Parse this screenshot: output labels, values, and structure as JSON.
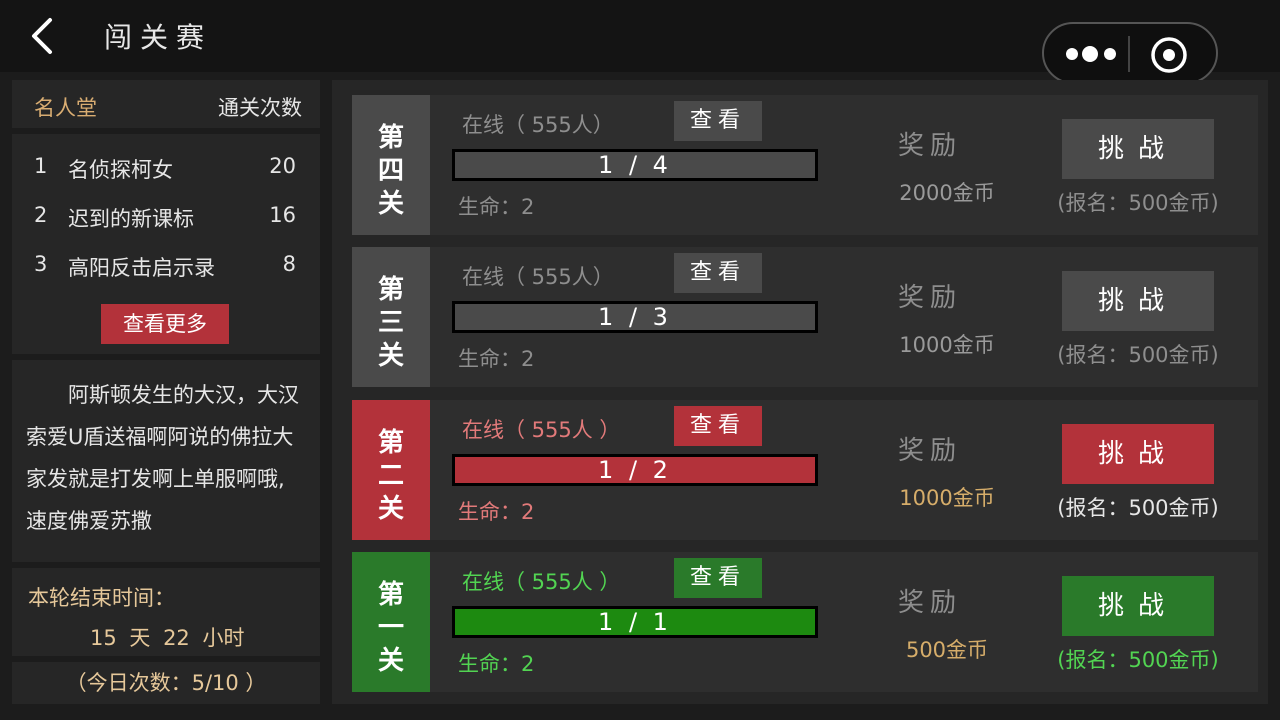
{
  "header": {
    "title": "闯关赛"
  },
  "hall": {
    "title": "名人堂",
    "count_header": "通关次数",
    "rows": [
      {
        "rank": "1",
        "name": "名侦探柯女",
        "count": "20"
      },
      {
        "rank": "2",
        "name": "迟到的新课标",
        "count": "16"
      },
      {
        "rank": "3",
        "name": "高阳反击启示录",
        "count": "8"
      }
    ],
    "more_label": "查看更多"
  },
  "description": "阿斯顿发生的大汉，大汉索爱U盾送福啊阿说的佛拉大家发就是打发啊上单服啊哦, 速度佛爱苏撒",
  "round": {
    "end_label": "本轮结束时间：",
    "end_value": "15 天 22 小时",
    "today_label": "（今日次数：5/10 ）"
  },
  "levels": [
    {
      "name": "第四关",
      "online": "在线（ 555人）",
      "view": "查看",
      "progress": "1 / 4",
      "fill": 1.0,
      "life": "生命：2",
      "reward_label": "奖励",
      "reward": "2000金币",
      "challenge": "挑战",
      "signup": "(报名：500金币)",
      "theme": "grey"
    },
    {
      "name": "第三关",
      "online": "在线（ 555人）",
      "view": "查看",
      "progress": "1 / 3",
      "fill": 1.0,
      "life": "生命：2",
      "reward_label": "奖励",
      "reward": "1000金币",
      "challenge": "挑战",
      "signup": "(报名：500金币)",
      "theme": "grey"
    },
    {
      "name": "第二关",
      "online": "在线（ 555人 ）",
      "view": "查看",
      "progress": "1 / 2",
      "fill": 1.0,
      "life": "生命：2",
      "reward_label": "奖励",
      "reward": "1000金币",
      "challenge": "挑战",
      "signup": "(报名：500金币)",
      "theme": "red"
    },
    {
      "name": "第一关",
      "online": "在线（ 555人 ）",
      "view": "查看",
      "progress": "1 / 1",
      "fill": 1.0,
      "life": "生命：2",
      "reward_label": "奖励",
      "reward": "500金币",
      "challenge": "挑战",
      "signup": "(报名：500金币)",
      "theme": "green"
    }
  ],
  "colors": {
    "grey": {
      "main": "#4a4a4a",
      "bar": "#4a4a4a",
      "text": "#8e8e8e",
      "reward": "#9a9a9a"
    },
    "red": {
      "main": "#b3323a",
      "bar": "#b3323a",
      "text": "#e27a7a",
      "reward": "#d6ad6a"
    },
    "green": {
      "main": "#2a7a2a",
      "bar": "#1d8a10",
      "text": "#52d452",
      "reward": "#d6ad6a"
    }
  },
  "icons": {
    "back": "chevron-left-icon",
    "more": "more-dots-icon",
    "target": "target-icon"
  }
}
